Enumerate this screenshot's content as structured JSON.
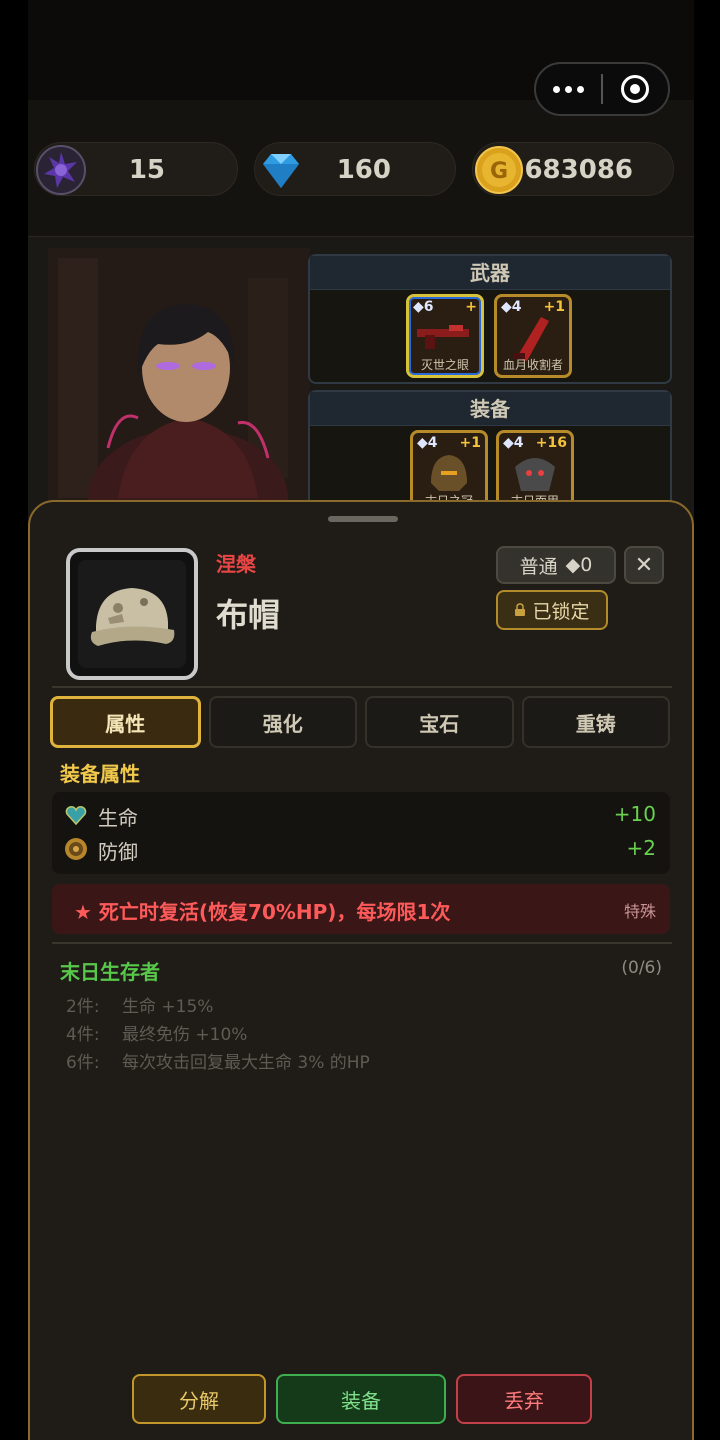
{
  "currencies": [
    {
      "name": "dark-gem",
      "value": "15",
      "color": "#4a2f7a"
    },
    {
      "name": "diamond",
      "value": "160",
      "color": "#35a7e8"
    },
    {
      "name": "gold",
      "value": "683086",
      "color": "#d9a11c"
    }
  ],
  "weapons_panel": {
    "title": "武器",
    "slots": [
      {
        "level": "◆6",
        "plus": "+",
        "name": "灭世之眼"
      },
      {
        "level": "◆4",
        "plus": "+1",
        "name": "血月收割者"
      }
    ]
  },
  "gear_panel": {
    "title": "装备",
    "slots": [
      {
        "level": "◆4",
        "plus": "+1",
        "name": "末日之冠"
      },
      {
        "level": "◆4",
        "plus": "+16",
        "name": "末日面甲"
      }
    ]
  },
  "item": {
    "rarity": "涅槃",
    "name": "布帽",
    "quality": "普通",
    "quality_value": "◆0",
    "lock_label": "已锁定",
    "close_label": "✕"
  },
  "tabs": [
    {
      "label": "属性",
      "active": true
    },
    {
      "label": "强化",
      "active": false
    },
    {
      "label": "宝石",
      "active": false
    },
    {
      "label": "重铸",
      "active": false
    }
  ],
  "attributes": {
    "title": "装备属性",
    "stats": [
      {
        "label": "生命",
        "value": "+10",
        "icon": "heart-gem-icon"
      },
      {
        "label": "防御",
        "value": "+2",
        "icon": "shield-coin-icon"
      }
    ],
    "special": {
      "text": "★ 死亡时复活(恢复70%HP)，每场限1次",
      "tag": "特殊"
    }
  },
  "set_bonus": {
    "name": "末日生存者",
    "count": "(0/6)",
    "bonuses": [
      {
        "pieces": "2件:",
        "desc": "生命 +15%"
      },
      {
        "pieces": "4件:",
        "desc": "最终免伤 +10%"
      },
      {
        "pieces": "6件:",
        "desc": "每次攻击回复最大生命 3% 的HP"
      }
    ]
  },
  "actions": {
    "disassemble": "分解",
    "equip": "装备",
    "discard": "丢弃"
  }
}
